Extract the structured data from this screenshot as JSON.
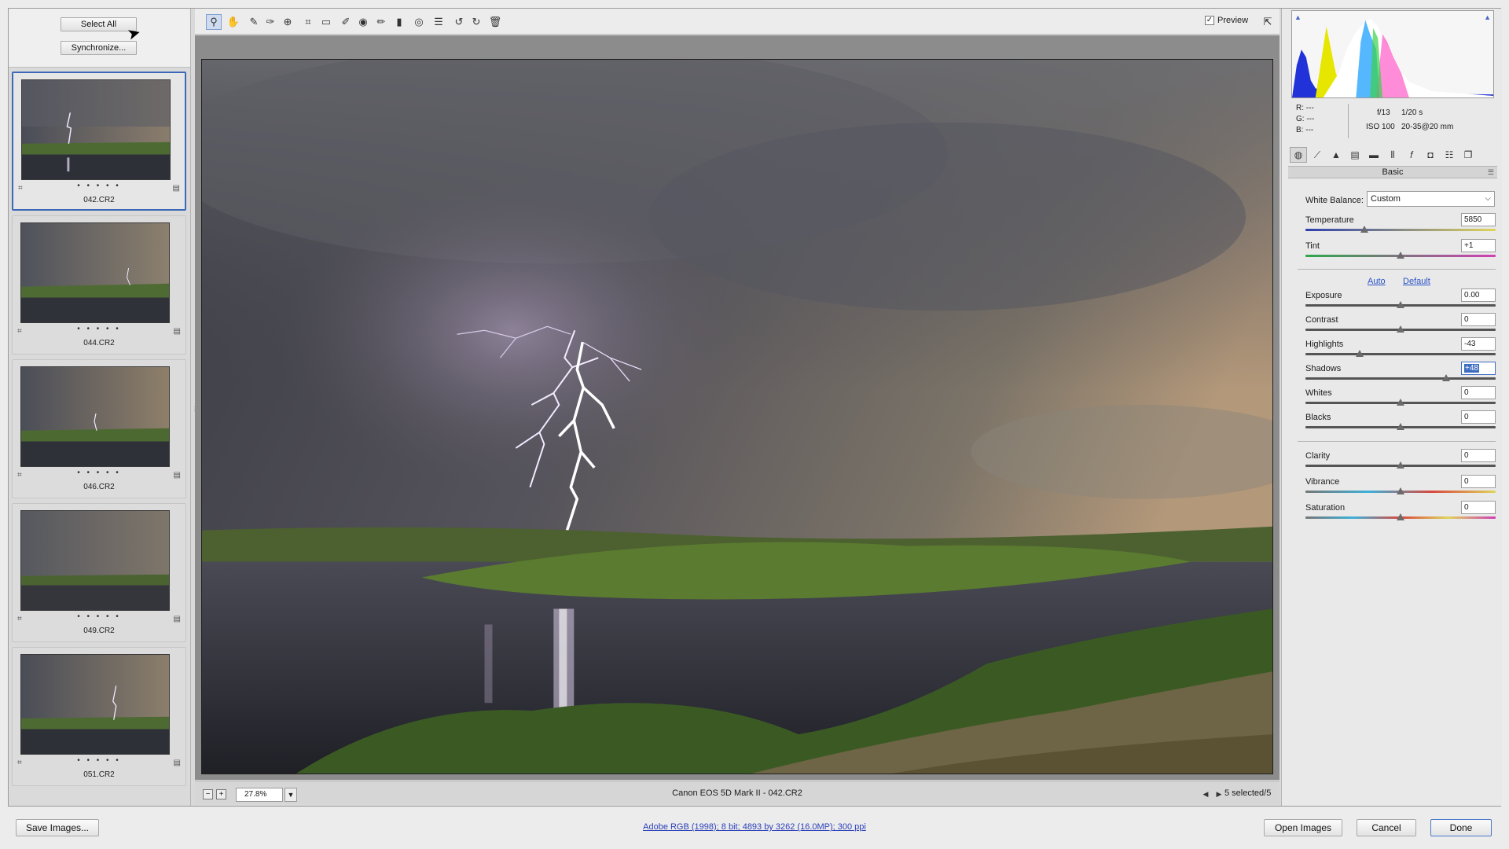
{
  "filmstrip": {
    "select_all_label": "Select All",
    "synchronize_label": "Synchronize...",
    "rating_dots": "• • • • •",
    "thumbnails": [
      {
        "name": "042.CR2",
        "selected": true
      },
      {
        "name": "044.CR2",
        "selected": false
      },
      {
        "name": "046.CR2",
        "selected": false
      },
      {
        "name": "049.CR2",
        "selected": false
      },
      {
        "name": "051.CR2",
        "selected": false
      }
    ]
  },
  "toolbar": {
    "tools": [
      "zoom-icon",
      "hand-icon",
      "white-balance-icon",
      "color-sampler-icon",
      "targeted-adjustment-icon",
      "crop-icon",
      "straighten-icon",
      "spot-removal-icon",
      "red-eye-icon",
      "adjustment-brush-icon",
      "graduated-filter-icon",
      "radial-filter-icon",
      "presets-list-icon",
      "rotate-ccw-icon",
      "rotate-cw-icon",
      "trash-icon"
    ],
    "preview_label": "Preview",
    "preview_checked": true
  },
  "status": {
    "zoom": "27.8%",
    "filename": "Canon EOS 5D Mark II  -  042.CR2",
    "selected_count": "5 selected/5"
  },
  "info": {
    "r_label": "R:",
    "r_value": "---",
    "g_label": "G:",
    "g_value": "---",
    "b_label": "B:",
    "b_value": "---",
    "aperture": "f/13",
    "shutter": "1/20 s",
    "iso": "ISO 100",
    "lens": "20-35@20 mm"
  },
  "panel": {
    "section_title": "Basic",
    "white_balance_label": "White Balance:",
    "white_balance_value": "Custom",
    "auto_label": "Auto",
    "default_label": "Default",
    "sliders": {
      "temperature": {
        "label": "Temperature",
        "value": "5850",
        "position": 0.31
      },
      "tint": {
        "label": "Tint",
        "value": "+1",
        "position": 0.5
      },
      "exposure": {
        "label": "Exposure",
        "value": "0.00",
        "position": 0.5
      },
      "contrast": {
        "label": "Contrast",
        "value": "0",
        "position": 0.5
      },
      "highlights": {
        "label": "Highlights",
        "value": "-43",
        "position": 0.285
      },
      "shadows": {
        "label": "Shadows",
        "value": "+48",
        "position": 0.74
      },
      "whites": {
        "label": "Whites",
        "value": "0",
        "position": 0.5
      },
      "blacks": {
        "label": "Blacks",
        "value": "0",
        "position": 0.5
      },
      "clarity": {
        "label": "Clarity",
        "value": "0",
        "position": 0.5
      },
      "vibrance": {
        "label": "Vibrance",
        "value": "0",
        "position": 0.5
      },
      "saturation": {
        "label": "Saturation",
        "value": "0",
        "position": 0.5
      }
    }
  },
  "bottom": {
    "save_images_label": "Save Images...",
    "workflow_options": "Adobe RGB (1998); 8 bit; 4893 by 3262 (16.0MP); 300 ppi",
    "open_images_label": "Open Images",
    "cancel_label": "Cancel",
    "done_label": "Done"
  },
  "colors": {
    "accent": "#3d68b8",
    "link": "#2b54c7"
  }
}
